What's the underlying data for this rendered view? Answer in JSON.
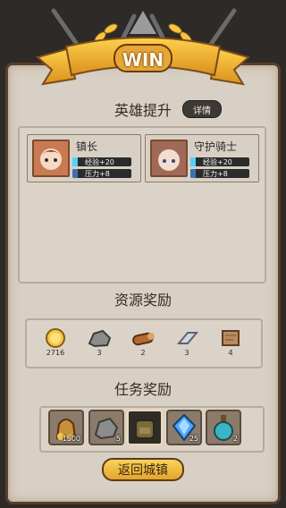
{
  "banner": {
    "title": "WIN"
  },
  "hero_section": {
    "title": "英雄提升",
    "detail_label": "详情",
    "heroes": [
      {
        "name": "镇长",
        "exp": "经验+20",
        "pressure": "压力+8"
      },
      {
        "name": "守护骑士",
        "exp": "经验+20",
        "pressure": "压力+8"
      }
    ]
  },
  "resource_section": {
    "title": "资源奖励",
    "items": [
      {
        "icon": "gold-coin-icon",
        "count": "2716"
      },
      {
        "icon": "stone-icon",
        "count": "3"
      },
      {
        "icon": "wood-log-icon",
        "count": "2"
      },
      {
        "icon": "iron-ingot-icon",
        "count": "3"
      },
      {
        "icon": "leather-scroll-icon",
        "count": "4"
      }
    ]
  },
  "task_section": {
    "title": "任务奖励",
    "items": [
      {
        "icon": "gold-sack-icon",
        "count": "1500"
      },
      {
        "icon": "stone-icon",
        "count": "5"
      },
      {
        "icon": "backpack-icon",
        "count": ""
      },
      {
        "icon": "crystal-icon",
        "count": "25"
      },
      {
        "icon": "potion-bottle-icon",
        "count": "2"
      }
    ]
  },
  "actions": {
    "return_label": "返回城镇"
  },
  "colors": {
    "exp_bar": "#4fd4ff",
    "pressure_bar": "#3e6fb8",
    "gold": "#f2c94c"
  }
}
